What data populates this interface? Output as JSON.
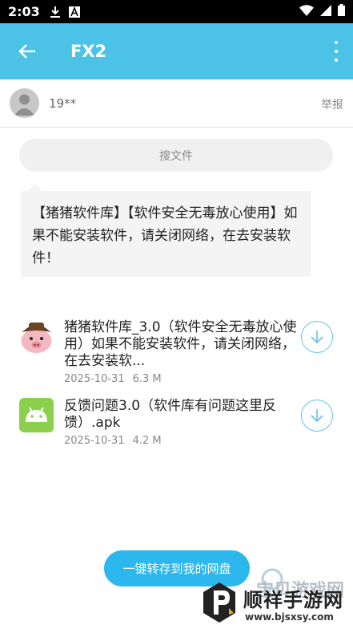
{
  "status_bar": {
    "time": "2:03"
  },
  "app_bar": {
    "title": "FX2"
  },
  "user": {
    "name": "19**",
    "report_label": "举报"
  },
  "search": {
    "label": "搜文件"
  },
  "notice": {
    "text": "【猪猪软件库】【软件安全无毒放心使用】如果不能安装软件，请关闭网络，在去安装软件！"
  },
  "files": [
    {
      "name": "猪猪软件库_3.0（软件安全无毒放心使用）如果不能安装软件，请关闭网络，在去安装软...",
      "date": "2025-10-31",
      "size": "6.3 M",
      "icon": "pig-app-icon"
    },
    {
      "name": "反馈问题3.0（软件库有问题这里反馈）.apk",
      "date": "2025-10-31",
      "size": "4.2 M",
      "icon": "android-apk-icon"
    }
  ],
  "save_button": {
    "label": "一键转存到我的网盘"
  },
  "watermark": {
    "main": "宝贝游戏网",
    "brand": "顺祥手游网",
    "url": "www.bjsxsy.com"
  },
  "colors": {
    "accent": "#4cc2e6",
    "button": "#2cb8ed",
    "download_ring": "#5fc3ea",
    "apk_green": "#8ccf4d"
  }
}
